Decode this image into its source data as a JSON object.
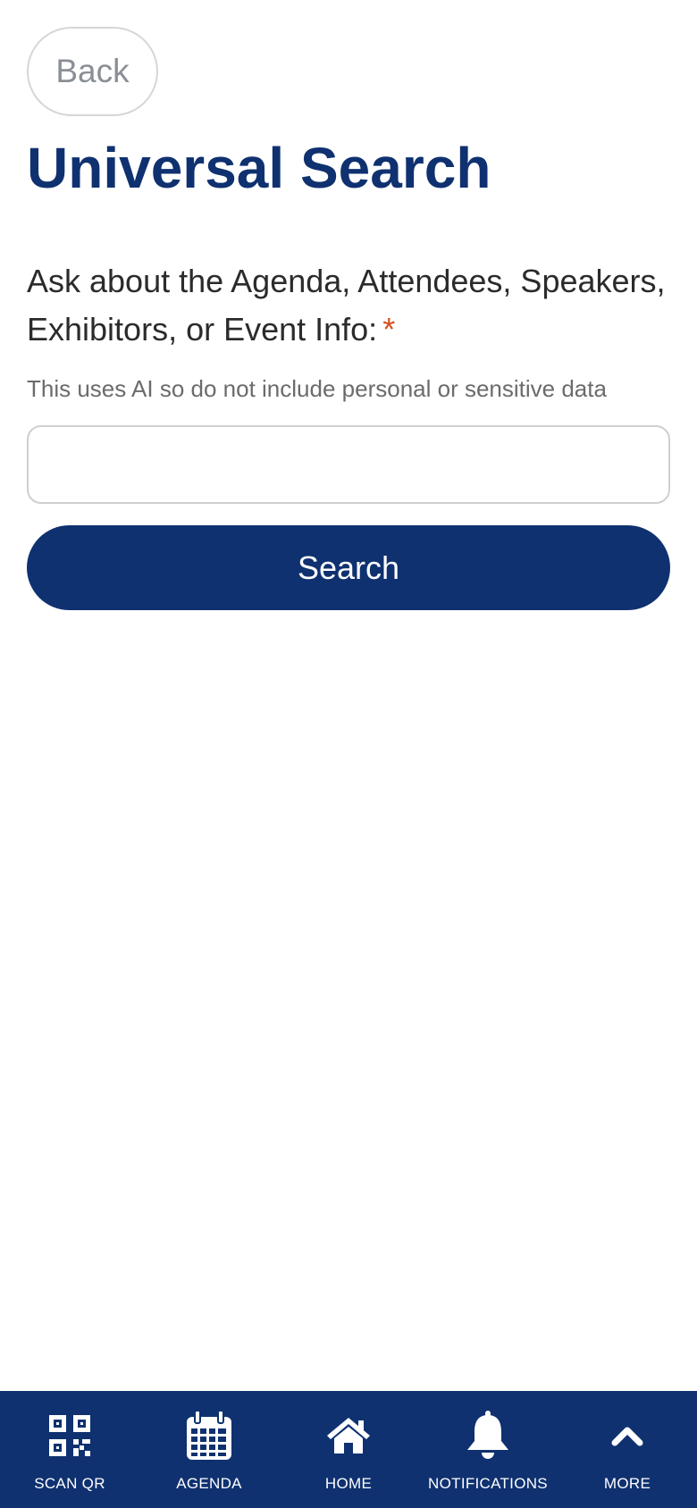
{
  "header": {
    "back_label": "Back",
    "title": "Universal Search"
  },
  "form": {
    "label": "Ask about the Agenda, Attendees, Speakers, Exhibitors, or Event Info:",
    "required_mark": "*",
    "hint": "This uses AI so do not include personal or sensitive data",
    "input_value": "",
    "submit_label": "Search"
  },
  "tab_bar": {
    "items": [
      {
        "label": "SCAN QR",
        "icon": "qr-code-icon"
      },
      {
        "label": "AGENDA",
        "icon": "calendar-icon"
      },
      {
        "label": "HOME",
        "icon": "home-icon"
      },
      {
        "label": "NOTIFICATIONS",
        "icon": "bell-icon"
      },
      {
        "label": "MORE",
        "icon": "chevron-up-icon"
      }
    ]
  },
  "colors": {
    "brand": "#0f3170",
    "required": "#d4501f",
    "text": "#2b2b2b",
    "muted": "#6b6b6b",
    "border": "#cfcfcf"
  }
}
